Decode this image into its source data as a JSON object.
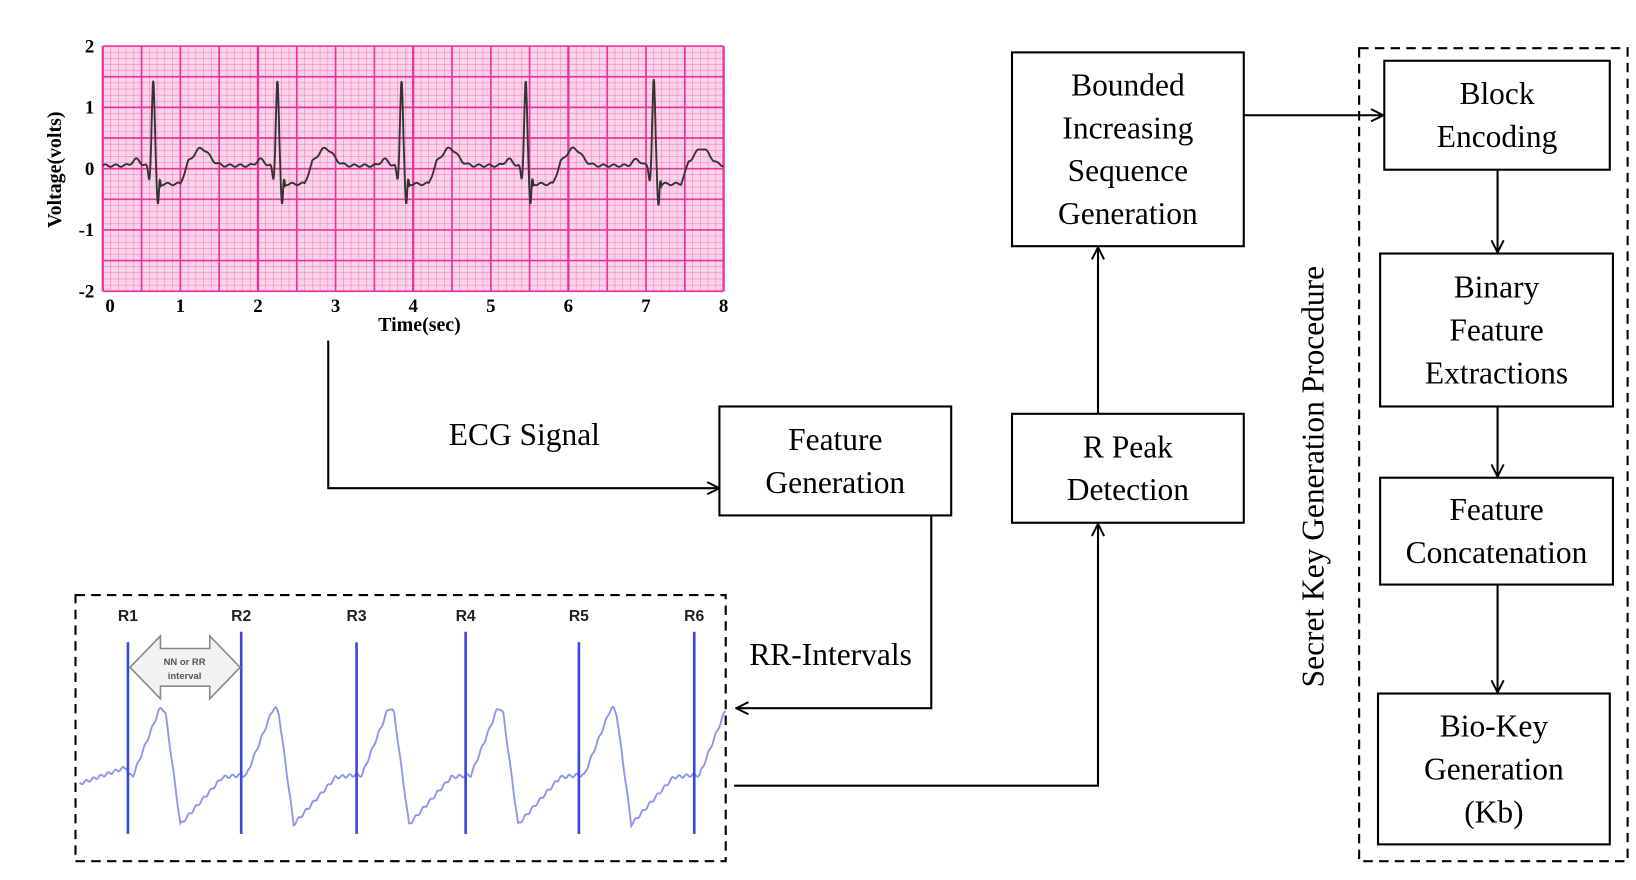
{
  "chart_data": {
    "type": "line",
    "title": "",
    "xlabel": "Time(sec)",
    "ylabel": "Voltage(volts)",
    "xlim": [
      0,
      8
    ],
    "ylim": [
      -2,
      2
    ],
    "xticks": [
      "0",
      "1",
      "2",
      "3",
      "4",
      "5",
      "6",
      "7",
      "8"
    ],
    "yticks": [
      "2",
      "1",
      "0",
      "-1",
      "-2"
    ],
    "grid": true,
    "background_color": "#fbd3e9",
    "grid_color": "#e8359b",
    "line_color": "#333333",
    "r_peak_times": [
      0.65,
      2.25,
      3.85,
      5.45,
      7.1
    ],
    "r_peak_amplitude": 1.4,
    "s_wave_min": -0.55
  },
  "rr_panel": {
    "peak_labels": [
      "R1",
      "R2",
      "R3",
      "R4",
      "R5",
      "R6"
    ],
    "interval_label_line1": "NN or RR",
    "interval_label_line2": "interval",
    "line_color": "#3b45e0"
  },
  "labels": {
    "ecg_signal": "ECG Signal",
    "rr_intervals": "RR-Intervals",
    "procedure": "Secret Key Generation Procedure"
  },
  "boxes": {
    "feature_generation": [
      "Feature",
      "Generation"
    ],
    "r_peak_detection": [
      "R Peak",
      "Detection"
    ],
    "bounded_sequence": [
      "Bounded",
      "Increasing",
      "Sequence",
      "Generation"
    ],
    "block_encoding": [
      "Block",
      "Encoding"
    ],
    "binary_feature": [
      "Binary",
      "Feature",
      "Extractions"
    ],
    "feature_concatenation": [
      "Feature",
      "Concatenation"
    ],
    "bio_key": [
      "Bio-Key",
      "Generation",
      "(Kb)"
    ]
  }
}
